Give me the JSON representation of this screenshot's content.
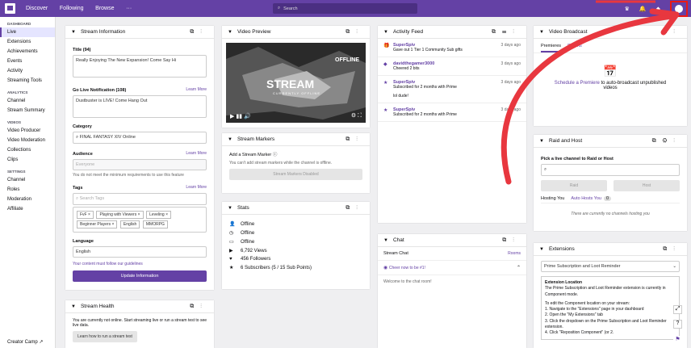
{
  "topbar": {
    "nav": [
      "Discover",
      "Following",
      "Browse",
      "···"
    ],
    "search_placeholder": "Search"
  },
  "sidebar": {
    "sections": [
      {
        "header": "DASHBOARD",
        "items": [
          "Live",
          "Extensions",
          "Achievements",
          "Events",
          "Activity",
          "Streaming Tools"
        ]
      },
      {
        "header": "ANALYTICS",
        "items": [
          "Channel",
          "Stream Summary"
        ]
      },
      {
        "header": "VIDEOS",
        "items": [
          "Video Producer",
          "Video Moderation",
          "Collections",
          "Clips"
        ]
      },
      {
        "header": "SETTINGS",
        "items": [
          "Channel",
          "Roles",
          "Moderation",
          "Affiliate"
        ]
      }
    ],
    "active_item": "Live",
    "footer": "Creator Camp"
  },
  "stream_info": {
    "title": "Stream Information",
    "title_label": "Title (94)",
    "title_value": "Really Enjoying The New Expansion! Come Say Hi",
    "notif_label": "Go Live Notification (108)",
    "notif_value": "Dustbuster is LIVE! Come Hang Out",
    "learn_more": "Learn More",
    "category_label": "Category",
    "category_value": "FINAL FANTASY XIV Online",
    "audience_label": "Audience",
    "audience_value": "Everyone",
    "audience_note": "You do not meet the minimum requirements to use this feature",
    "tags_label": "Tags",
    "tags_placeholder": "Search Tags",
    "tags": [
      "FvF",
      "Playing with Viewers",
      "Leveling",
      "Beginner Players",
      "English",
      "MMORPG"
    ],
    "language_label": "Language",
    "language_value": "English",
    "guide_note": "Your content must follow our guidelines",
    "update_button": "Update Information"
  },
  "stream_health": {
    "title": "Stream Health",
    "text": "You are currently not online. Start streaming live or run a stream test to see live data.",
    "button": "Learn how to run a stream test"
  },
  "video_preview": {
    "title": "Video Preview",
    "offline": "OFFLINE",
    "stream_text": "STREAM",
    "stream_sub": "CURRENTLY OFFLINE"
  },
  "stream_markers": {
    "title": "Stream Markers",
    "add_label": "Add a Stream Marker",
    "note": "You can't add stream markers while the channel is offline.",
    "button": "Stream Markers Disabled"
  },
  "stats": {
    "title": "Stats",
    "items": [
      "Offline",
      "Offline",
      "Offline",
      "6,792 Views",
      "456 Followers",
      "6 Subscribers (5 / 15 Sub Points)"
    ]
  },
  "activity_feed": {
    "title": "Activity Feed",
    "items": [
      {
        "user": "SuperSpiv",
        "desc": "Gave out 1 Tier 1 Community Sub gifts",
        "time": "3 days ago",
        "extra": ""
      },
      {
        "user": "davidthegamer3000",
        "desc": "Cheered 2 bits",
        "time": "3 days ago",
        "extra": ""
      },
      {
        "user": "SuperSpiv",
        "desc": "Subscribed for 2 months with Prime",
        "time": "3 days ago",
        "extra": "lol dude!"
      },
      {
        "user": "SuperSpiv",
        "desc": "Subscribed for 2 months with Prime",
        "time": "3 days ago",
        "extra": ""
      }
    ]
  },
  "chat": {
    "title": "Chat",
    "stream_chat": "Stream Chat",
    "rooms": "Rooms",
    "cheer": "Cheer now to be #1!",
    "welcome": "Welcome to the chat room!"
  },
  "video_broadcast": {
    "title": "Video Broadcast",
    "tabs": [
      "Premieres",
      "Reruns"
    ],
    "schedule_link": "Schedule a Premiere",
    "schedule_text": "to auto-broadcast unpublished videos"
  },
  "raid_host": {
    "title": "Raid and Host",
    "pick_label": "Pick a live channel to Raid or Host",
    "raid_button": "Raid",
    "host_button": "Host",
    "tabs": [
      "Hosting You",
      "Auto Hosts You"
    ],
    "auto_count": "0",
    "empty": "There are currently no channels hosting you"
  },
  "extensions": {
    "title": "Extensions",
    "select_value": "Prime Subscription and Loot Reminder",
    "box_title": "Extension Location",
    "box_text": "The Prime Subscription and Loot Reminder extension is currently in Component mode.",
    "box_instr": "To edit the Component location on your stream:",
    "steps": [
      "1. Navigate to the \"Extensions\" page in your dashboard",
      "2. Open the \"My Extensions\" tab",
      "3. Click the dropdown on the Prime Subscription and Loot Reminder extension.",
      "4. Click \"Reposition Component\" (or 2."
    ]
  }
}
